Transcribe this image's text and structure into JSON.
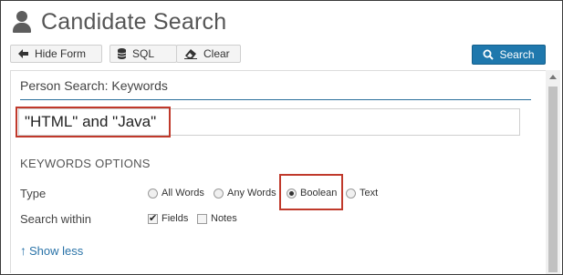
{
  "header": {
    "title": "Candidate Search",
    "icon": "person-icon"
  },
  "toolbar": {
    "hide_form": "Hide Form",
    "sql": "SQL",
    "clear": "Clear",
    "search": "Search"
  },
  "panel": {
    "title": "Person Search: Keywords",
    "keywords_value": "\"HTML\" and \"Java\"",
    "section_title": "KEYWORDS OPTIONS",
    "type_label": "Type",
    "type_options": [
      {
        "label": "All Words",
        "checked": false
      },
      {
        "label": "Any Words",
        "checked": false
      },
      {
        "label": "Boolean",
        "checked": true
      },
      {
        "label": "Text",
        "checked": false
      }
    ],
    "within_label": "Search within",
    "within_options": [
      {
        "label": "Fields",
        "checked": true
      },
      {
        "label": "Notes",
        "checked": false
      }
    ],
    "show_less": "Show less"
  },
  "colors": {
    "accent": "#1f78ad",
    "highlight": "#c0392b",
    "link": "#2a73a8"
  }
}
